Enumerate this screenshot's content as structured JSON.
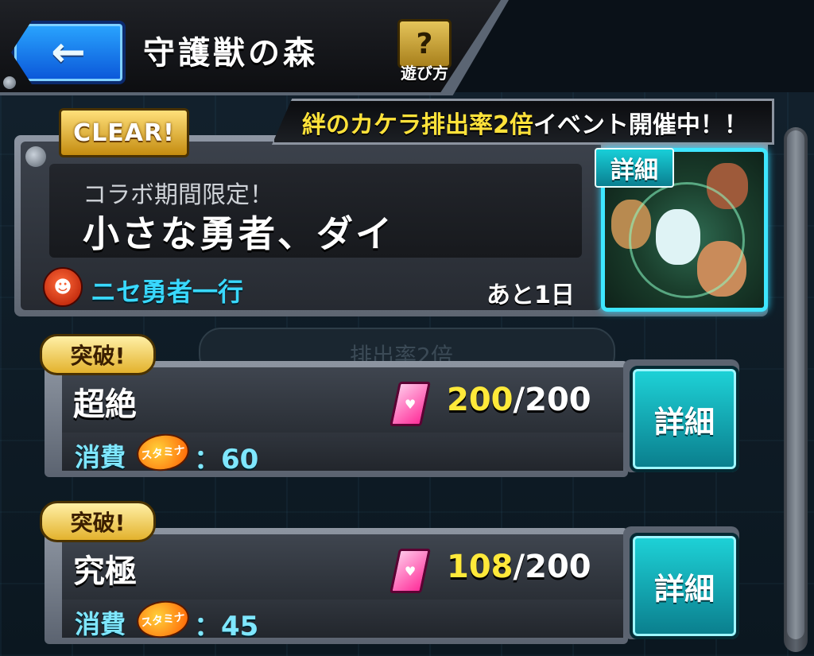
{
  "header": {
    "title": "守護獣の森",
    "help_glyph": "?",
    "help_label": "遊び方",
    "back_icon": "←"
  },
  "quest": {
    "clear_badge": "CLEAR!",
    "event_prefix": "絆のカケラ排出率2倍",
    "event_suffix": "イベント開催中！！",
    "subtitle": "コラボ期間限定！",
    "title": "小さな勇者、ダイ",
    "enemy_name": "ニセ勇者一行",
    "remaining": "あと1日",
    "portrait_label": "詳細"
  },
  "ghost": {
    "text": "排出率2倍"
  },
  "difficulties": [
    {
      "badge": "突破!",
      "name": "超絶",
      "current": "200",
      "separator_max": "/200",
      "cost_label": "消費",
      "stamina_label": "スタミナ",
      "cost_value": "：60",
      "detail_label": "詳細"
    },
    {
      "badge": "突破!",
      "name": "究極",
      "current": "108",
      "separator_max": "/200",
      "cost_label": "消費",
      "stamina_label": "スタミナ",
      "cost_value": "：45",
      "detail_label": "詳細"
    }
  ],
  "colors": {
    "accent_cyan": "#3ee6ff",
    "highlight_yellow": "#ffe93a",
    "back_blue": "#1a7ff0"
  }
}
